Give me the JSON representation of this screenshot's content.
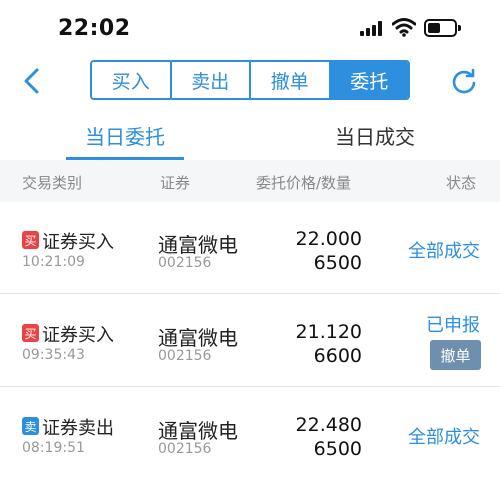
{
  "status_bar": {
    "time": "22:02"
  },
  "nav": {
    "segments": [
      {
        "label": "买入",
        "active": false
      },
      {
        "label": "卖出",
        "active": false
      },
      {
        "label": "撤单",
        "active": false
      },
      {
        "label": "委托",
        "active": true
      }
    ]
  },
  "tabs": [
    {
      "label": "当日委托",
      "active": true
    },
    {
      "label": "当日成交",
      "active": false
    }
  ],
  "columns": {
    "type": "交易类别",
    "security": "证券",
    "price_qty": "委托价格/数量",
    "status": "状态"
  },
  "orders": [
    {
      "badge": "买",
      "side": "buy",
      "type": "证券买入",
      "time": "10:21:09",
      "name": "通富微电",
      "code": "002156",
      "price": "22.000",
      "qty": "6500",
      "status": "全部成交"
    },
    {
      "badge": "买",
      "side": "buy",
      "type": "证券买入",
      "time": "09:35:43",
      "name": "通富微电",
      "code": "002156",
      "price": "21.120",
      "qty": "6600",
      "status": "已申报",
      "cancel_label": "撤单"
    },
    {
      "badge": "卖",
      "side": "sell",
      "type": "证券卖出",
      "time": "08:19:51",
      "name": "通富微电",
      "code": "002156",
      "price": "22.480",
      "qty": "6500",
      "status": "全部成交"
    }
  ],
  "colors": {
    "accent": "#2d8fde",
    "buy": "#e94343",
    "sell": "#2d8fde",
    "cancel_button": "#6e8fae"
  }
}
